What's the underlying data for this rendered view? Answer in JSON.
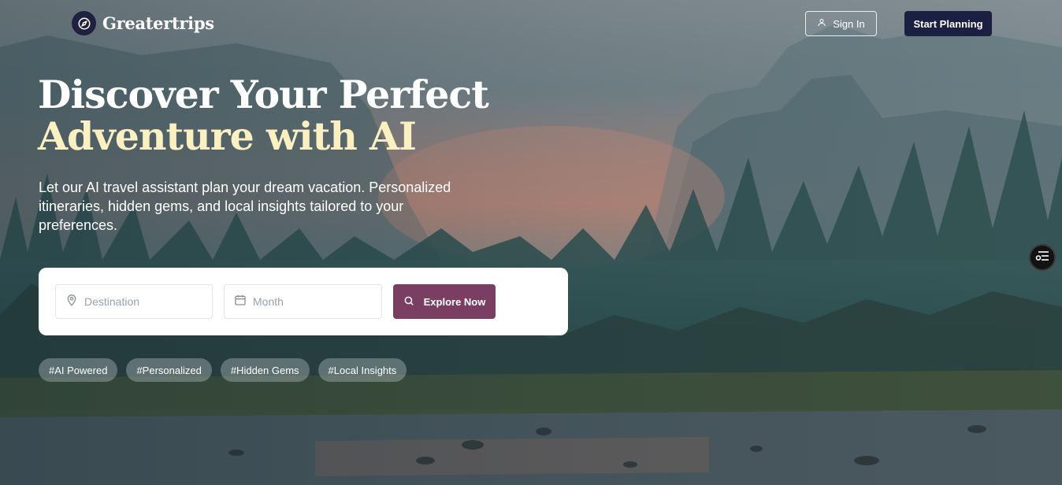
{
  "brand": {
    "name": "Greatertrips",
    "icon": "compass-icon"
  },
  "nav": {
    "sign_in_label": "Sign In",
    "sign_in_icon": "user-icon",
    "start_planning_label": "Start Planning"
  },
  "hero": {
    "title_line1": "Discover Your Perfect",
    "title_line2": "Adventure with AI",
    "subtitle": "Let our AI travel assistant plan your dream vacation. Personalized itineraries, hidden gems, and local insights tailored to your preferences."
  },
  "search": {
    "destination_placeholder": "Destination",
    "destination_icon": "map-pin-icon",
    "month_placeholder": "Month",
    "month_icon": "calendar-icon",
    "explore_label": "Explore Now",
    "explore_icon": "search-icon"
  },
  "tags": [
    "#AI Powered",
    "#Personalized",
    "#Hidden Gems",
    "#Local Insights"
  ],
  "floating_button": {
    "icon": "filter-list-icon"
  },
  "colors": {
    "brand_navy": "#1b2042",
    "accent_plum": "#7a3e62",
    "title_highlight": "#fbf0c2"
  }
}
